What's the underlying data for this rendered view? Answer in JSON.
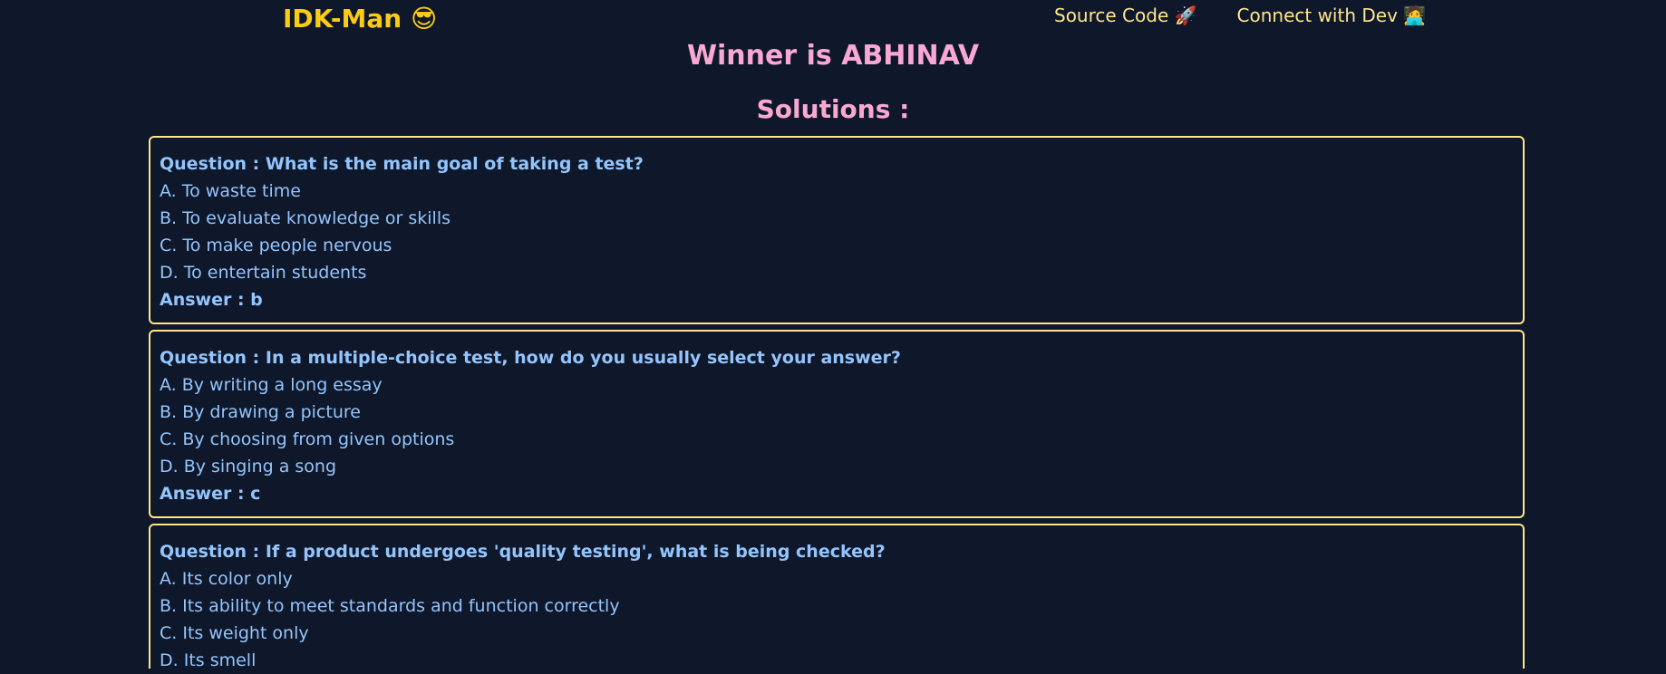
{
  "header": {
    "brand": "IDK-Man 😎",
    "nav": [
      {
        "label": "Source Code 🚀"
      },
      {
        "label": "Connect with Dev 🧑‍💻"
      }
    ]
  },
  "main": {
    "winner_text": "Winner is ABHINAV",
    "solutions_title": "Solutions :",
    "questions": [
      {
        "question": "Question : What is the main goal of taking a test?",
        "options": [
          "A. To waste time",
          "B. To evaluate knowledge or skills",
          "C. To make people nervous",
          "D. To entertain students"
        ],
        "answer": "Answer : b"
      },
      {
        "question": "Question : In a multiple-choice test, how do you usually select your answer?",
        "options": [
          "A. By writing a long essay",
          "B. By drawing a picture",
          "C. By choosing from given options",
          "D. By singing a song"
        ],
        "answer": "Answer : c"
      },
      {
        "question": "Question : If a product undergoes 'quality testing', what is being checked?",
        "options": [
          "A. Its color only",
          "B. Its ability to meet standards and function correctly",
          "C. Its weight only",
          "D. Its smell"
        ]
      }
    ]
  },
  "colors": {
    "background": "#0f172a",
    "brand": "#facc15",
    "nav": "#fde68a",
    "heading": "#f9a8d4",
    "card_border": "#fde68a",
    "card_text": "#93c5fd"
  }
}
